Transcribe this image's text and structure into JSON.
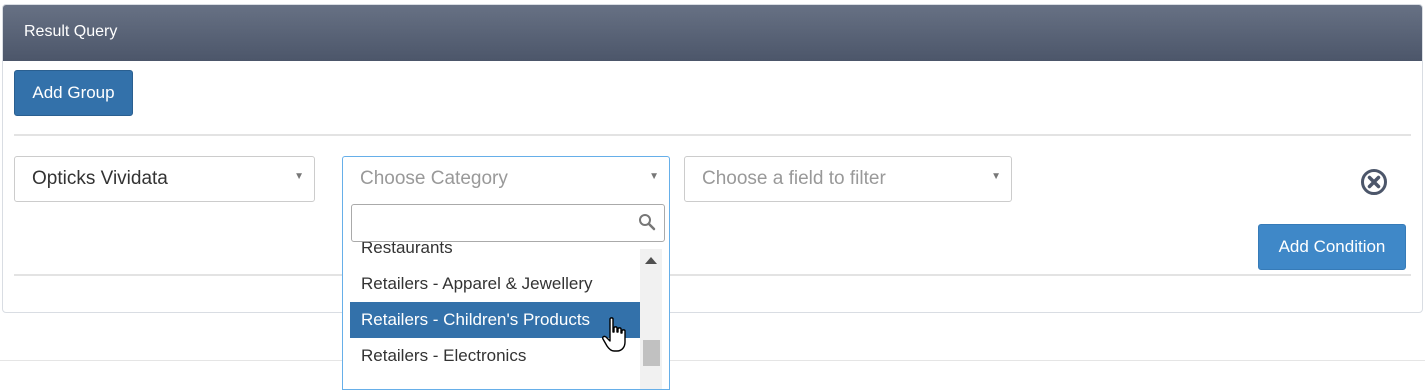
{
  "panel": {
    "title": "Result Query"
  },
  "buttons": {
    "add_group": "Add Group",
    "add_condition": "Add Condition"
  },
  "condition": {
    "source": {
      "value": "Opticks Vividata",
      "icon": "caret-down-icon"
    },
    "category": {
      "placeholder": "Choose Category",
      "search_value": "",
      "options": [
        "Restaurants",
        "Retailers - Apparel & Jewellery",
        "Retailers - Children's Products",
        "Retailers - Electronics"
      ],
      "highlighted": "Retailers - Children's Products"
    },
    "field": {
      "placeholder": "Choose a field to filter"
    },
    "remove_icon": "circle-x-icon"
  },
  "colors": {
    "header": "#4c566a",
    "primary": "#3371aa",
    "highlight": "#3371aa"
  }
}
